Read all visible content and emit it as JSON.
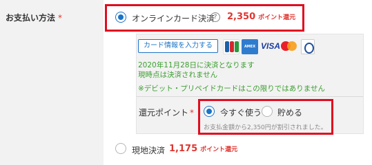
{
  "field": {
    "label": "お支払い方法",
    "required_mark": "*"
  },
  "online_payment": {
    "label": "オンラインカード決済",
    "help_icon": "?",
    "points_value": "2,350",
    "points_unit": "ポイント還元",
    "selected": true
  },
  "card_panel": {
    "input_button_label": "カード情報を入力する",
    "brands": [
      "JCB",
      "AMERICAN EXPRESS",
      "VISA",
      "mastercard",
      "Diners Club"
    ],
    "visa_text": "VISA",
    "amex_text": "AMEX",
    "mc_caption": "mastercard",
    "settlement_date_text": "2020年11月28日に決済となります",
    "not_settled_text": "現時点は決済されません",
    "card_exclusion_text": "※デビット・プリペイドカードはこの限りではありません"
  },
  "points_return": {
    "label": "還元ポイント",
    "required_mark": "*",
    "option_use_now": "今すぐ使う",
    "option_save": "貯める",
    "selected": "use_now",
    "discount_note": "お支払金額から2,350円が割引されました。"
  },
  "onsite_payment": {
    "label": "現地決済",
    "points_value": "1,175",
    "points_unit": "ポイント還元",
    "selected": false
  },
  "colors": {
    "accent_blue": "#1a73c7",
    "points_red": "#e0352f",
    "highlight_red": "#e00d1f",
    "note_green": "#3a9e2e"
  }
}
